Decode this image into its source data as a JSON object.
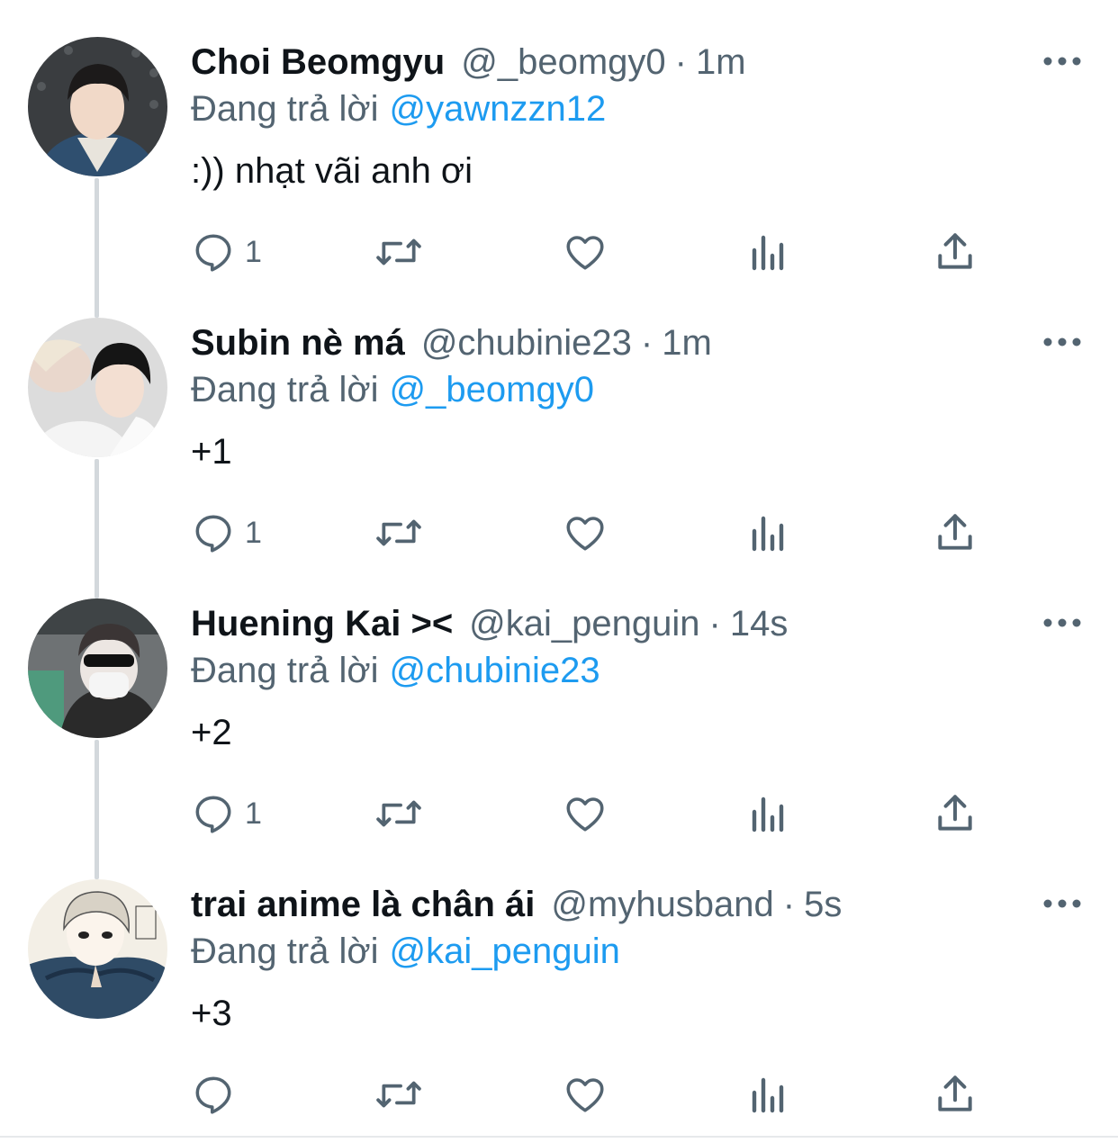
{
  "thread": {
    "tweets": [
      {
        "name": "Choi Beomgyu",
        "handle": "@_beomgy0",
        "separator": "·",
        "time": "1m",
        "reply_prefix": "Đang trả lời",
        "reply_to": "@yawnzzn12",
        "text": ":)) nhạt vãi anh ơi",
        "reply_count": "1"
      },
      {
        "name": "Subin nè má",
        "handle": "@chubinie23",
        "separator": "·",
        "time": "1m",
        "reply_prefix": "Đang trả lời",
        "reply_to": "@_beomgy0",
        "text": "+1",
        "reply_count": "1"
      },
      {
        "name": "Huening Kai ><",
        "handle": "@kai_penguin",
        "separator": "·",
        "time": "14s",
        "reply_prefix": "Đang trả lời",
        "reply_to": "@chubinie23",
        "text": "+2",
        "reply_count": "1"
      },
      {
        "name": "trai anime là chân ái",
        "handle": "@myhusband",
        "separator": "·",
        "time": "5s",
        "reply_prefix": "Đang trả lời",
        "reply_to": "@kai_penguin",
        "text": "+3",
        "reply_count": ""
      }
    ]
  },
  "colors": {
    "text_primary": "#0f1419",
    "text_secondary": "#536471",
    "link": "#1d9bf0",
    "thread_line": "#d3d8dc",
    "icon": "#536471"
  },
  "icons": {
    "reply": "reply-icon",
    "retweet": "retweet-icon",
    "like": "heart-icon",
    "views": "views-icon",
    "share": "share-icon",
    "more": "more-icon"
  }
}
